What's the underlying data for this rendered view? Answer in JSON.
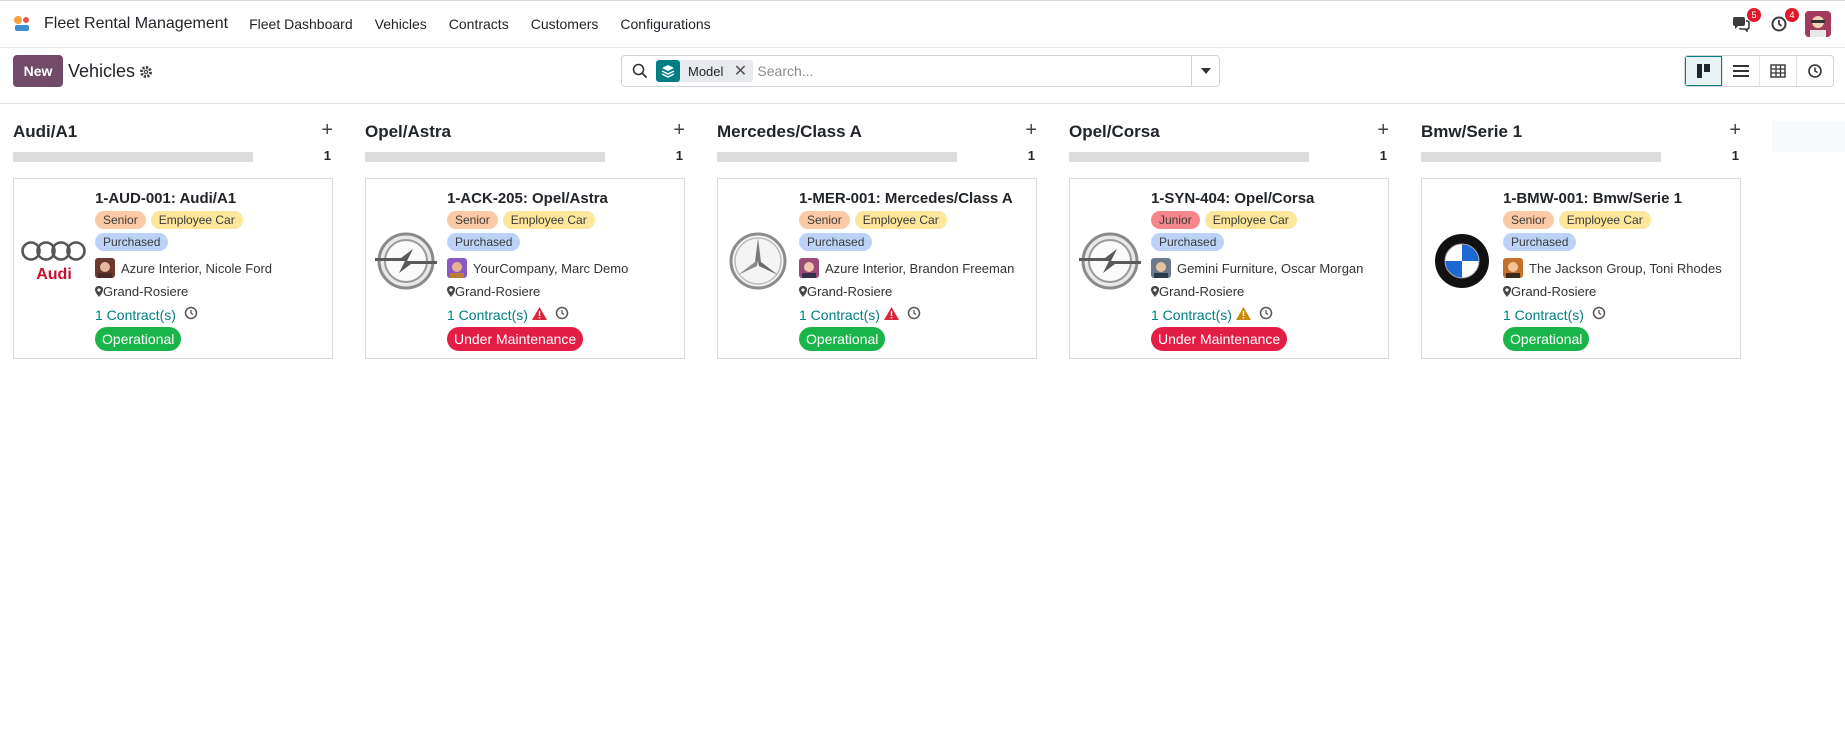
{
  "app": {
    "name": "Fleet Rental Management"
  },
  "menu": [
    "Fleet Dashboard",
    "Vehicles",
    "Contracts",
    "Customers",
    "Configurations"
  ],
  "systray": {
    "messages_count": "5",
    "activities_count": "4"
  },
  "control": {
    "new_label": "New",
    "breadcrumb": "Vehicles",
    "facet_label": "Model",
    "search_placeholder": "Search..."
  },
  "columns": [
    {
      "title": "Audi/A1",
      "count": "1",
      "card": {
        "title": "1-AUD-001: Audi/A1",
        "tags": [
          {
            "label": "Senior",
            "kind": "senior"
          },
          {
            "label": "Employee Car",
            "kind": "employee"
          },
          {
            "label": "Purchased",
            "kind": "purchased"
          }
        ],
        "driver": "Azure Interior, Nicole Ford",
        "location": "Grand-Rosiere",
        "contracts": "1 Contract(s)",
        "warning": false,
        "status": "Operational",
        "status_kind": "operational",
        "logo": "audi-logo"
      }
    },
    {
      "title": "Opel/Astra",
      "count": "1",
      "card": {
        "title": "1-ACK-205: Opel/Astra",
        "tags": [
          {
            "label": "Senior",
            "kind": "senior"
          },
          {
            "label": "Employee Car",
            "kind": "employee"
          },
          {
            "label": "Purchased",
            "kind": "purchased"
          }
        ],
        "driver": "YourCompany, Marc Demo",
        "location": "Grand-Rosiere",
        "contracts": "1 Contract(s)",
        "warning": "red",
        "status": "Under Maintenance",
        "status_kind": "maintenance",
        "logo": "opel-logo"
      }
    },
    {
      "title": "Mercedes/Class A",
      "count": "1",
      "card": {
        "title": "1-MER-001: Mercedes/Class A",
        "tags": [
          {
            "label": "Senior",
            "kind": "senior"
          },
          {
            "label": "Employee Car",
            "kind": "employee"
          },
          {
            "label": "Purchased",
            "kind": "purchased"
          }
        ],
        "driver": "Azure Interior, Brandon Freeman",
        "location": "Grand-Rosiere",
        "contracts": "1 Contract(s)",
        "warning": "red",
        "status": "Operational",
        "status_kind": "operational",
        "logo": "mercedes-logo"
      }
    },
    {
      "title": "Opel/Corsa",
      "count": "1",
      "card": {
        "title": "1-SYN-404: Opel/Corsa",
        "tags": [
          {
            "label": "Junior",
            "kind": "junior"
          },
          {
            "label": "Employee Car",
            "kind": "employee"
          },
          {
            "label": "Purchased",
            "kind": "purchased"
          }
        ],
        "driver": "Gemini Furniture, Oscar Morgan",
        "location": "Grand-Rosiere",
        "contracts": "1 Contract(s)",
        "warning": "orange",
        "status": "Under Maintenance",
        "status_kind": "maintenance",
        "logo": "opel-logo"
      }
    },
    {
      "title": "Bmw/Serie 1",
      "count": "1",
      "card": {
        "title": "1-BMW-001: Bmw/Serie 1",
        "tags": [
          {
            "label": "Senior",
            "kind": "senior"
          },
          {
            "label": "Employee Car",
            "kind": "employee"
          },
          {
            "label": "Purchased",
            "kind": "purchased"
          }
        ],
        "driver": "The Jackson Group, Toni Rhodes",
        "location": "Grand-Rosiere",
        "contracts": "1 Contract(s)",
        "warning": false,
        "status": "Operational",
        "status_kind": "operational",
        "logo": "bmw-logo"
      }
    }
  ],
  "colors": {
    "primary": "#714b67",
    "teal": "#017e84",
    "operational": "#1ab54a",
    "maintenance": "#e21e45"
  }
}
